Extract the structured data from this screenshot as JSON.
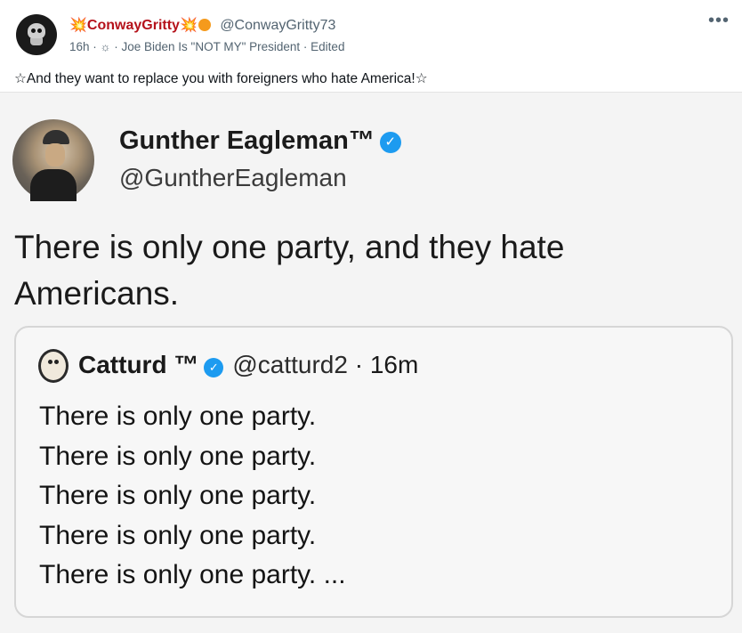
{
  "post": {
    "display_name": "ConwayGritty",
    "emoji_left": "💥",
    "emoji_right": "💥",
    "handle": "@ConwayGritty73",
    "time": "16h",
    "visibility_icon": "globe-icon",
    "community": "Joe Biden Is \"NOT MY\" President",
    "edited": "Edited",
    "more_label": "•••",
    "text": "☆And they want to replace you with foreigners who hate America!☆"
  },
  "image": {
    "author_name": "Gunther Eagleman™",
    "author_handle": "@GuntherEagleman",
    "verified_icon": "verified-badge-icon",
    "text": "There is only one party,  and they hate Americans.",
    "quote": {
      "author_name": "Catturd ™",
      "author_handle": "@catturd2",
      "time": "16m",
      "lines": [
        "There is only one party.",
        "There is only one party.",
        "There is only one party.",
        "There is only one party.",
        "There is only one party. ..."
      ]
    }
  },
  "colors": {
    "name": "#b5121b",
    "meta": "#536471",
    "verified": "#1d9bf0"
  }
}
